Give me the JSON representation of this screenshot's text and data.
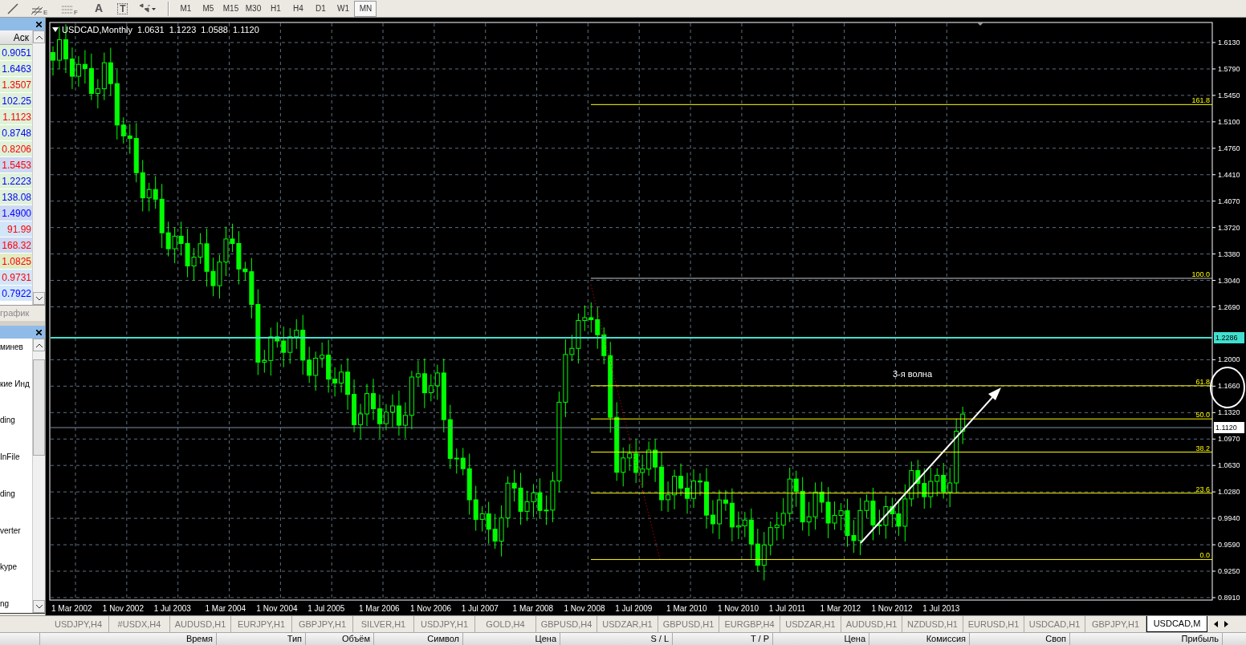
{
  "toolbar": {
    "tools": [
      {
        "kind": "trendline"
      },
      {
        "kind": "channel",
        "label": "E"
      },
      {
        "kind": "fibo",
        "label": "F"
      },
      {
        "kind": "text",
        "label": "A"
      },
      {
        "kind": "textlabel",
        "label": "T"
      },
      {
        "kind": "arrows"
      }
    ],
    "timeframes": [
      {
        "label": "M1",
        "selected": false
      },
      {
        "label": "M5",
        "selected": false
      },
      {
        "label": "M15",
        "selected": false
      },
      {
        "label": "M30",
        "selected": false
      },
      {
        "label": "H1",
        "selected": false
      },
      {
        "label": "H4",
        "selected": false
      },
      {
        "label": "D1",
        "selected": false
      },
      {
        "label": "W1",
        "selected": false
      },
      {
        "label": "MN",
        "selected": true
      }
    ]
  },
  "market_watch": {
    "column": "Аск",
    "rows": [
      {
        "ask": "0.9051",
        "color": "#0000ff",
        "kind": "green"
      },
      {
        "ask": "1.6463",
        "color": "#0000ff",
        "kind": "green"
      },
      {
        "ask": "1.3507",
        "color": "#ff0000",
        "kind": "green"
      },
      {
        "ask": "102.25",
        "color": "#0000ff",
        "kind": "green"
      },
      {
        "ask": "1.1123",
        "color": "#ff0000",
        "kind": "green"
      },
      {
        "ask": "0.8748",
        "color": "#0000ff",
        "kind": "green"
      },
      {
        "ask": "0.8206",
        "color": "#ff0000",
        "kind": "green"
      },
      {
        "ask": "1.5453",
        "color": "#ff0000",
        "kind": "lavender"
      },
      {
        "ask": "1.2223",
        "color": "#0000ff",
        "kind": "green"
      },
      {
        "ask": "138.08",
        "color": "#0000ff",
        "kind": "green"
      },
      {
        "ask": "1.4900",
        "color": "#0000ff",
        "kind": "lavender"
      },
      {
        "ask": "91.99",
        "color": "#ff0000",
        "kind": "sky"
      },
      {
        "ask": "168.32",
        "color": "#ff0000",
        "kind": "lavender"
      },
      {
        "ask": "1.0825",
        "color": "#ff0000",
        "kind": "olive"
      },
      {
        "ask": "0.9731",
        "color": "#ff0000",
        "kind": "sky"
      },
      {
        "ask": "0.7922",
        "color": "#0000ff",
        "kind": "sky"
      }
    ],
    "tab": "график"
  },
  "navigator": {
    "items": [
      "минев",
      "кие Инд",
      "ding",
      "InFile",
      "ding",
      "verter",
      "kype",
      "ng"
    ]
  },
  "chart": {
    "symbol": "USDCAD,Monthly",
    "ohlc": [
      "1.0631",
      "1.1223",
      "1.0588",
      "1.1120"
    ],
    "price_ticks": [
      "1.6130",
      "1.5790",
      "1.5450",
      "1.5100",
      "1.4760",
      "1.4410",
      "1.4070",
      "1.3720",
      "1.3380",
      "1.3040",
      "1.2690",
      "1.2000",
      "1.1660",
      "1.1320",
      "1.0970",
      "1.0630",
      "1.0280",
      "0.9940",
      "0.9590",
      "0.9250",
      "0.8910"
    ],
    "date_labels": [
      "1 Mar 2002",
      "1 Nov 2002",
      "1 Jul 2003",
      "1 Mar 2004",
      "1 Nov 2004",
      "1 Jul 2005",
      "1 Mar 2006",
      "1 Nov 2006",
      "1 Jul 2007",
      "1 Mar 2008",
      "1 Nov 2008",
      "1 Jul 2009",
      "1 Mar 2010",
      "1 Nov 2010",
      "1 Jul 2011",
      "1 Mar 2012",
      "1 Nov 2012",
      "1 Jul 2013"
    ],
    "fibo_levels": [
      "161.8",
      "100.0",
      "61.8",
      "50.0",
      "38.2",
      "23.6",
      "0.0"
    ],
    "horizontal_line_label": "1.2286",
    "current_price_label": "1.1120",
    "annotation": "3-я волна"
  },
  "chart_tabs": [
    {
      "label": "USDJPY,H4",
      "selected": false
    },
    {
      "label": "#USDX,H4",
      "selected": false
    },
    {
      "label": "AUDUSD,H1",
      "selected": false
    },
    {
      "label": "EURJPY,H1",
      "selected": false
    },
    {
      "label": "GBPJPY,H1",
      "selected": false
    },
    {
      "label": "SILVER,H1",
      "selected": false
    },
    {
      "label": "USDJPY,H1",
      "selected": false
    },
    {
      "label": "GOLD,H4",
      "selected": false
    },
    {
      "label": "GBPUSD,H4",
      "selected": false
    },
    {
      "label": "USDZAR,H1",
      "selected": false
    },
    {
      "label": "GBPUSD,H1",
      "selected": false
    },
    {
      "label": "EURGBP,H4",
      "selected": false
    },
    {
      "label": "USDZAR,H1",
      "selected": false
    },
    {
      "label": "AUDUSD,H1",
      "selected": false
    },
    {
      "label": "NZDUSD,H1",
      "selected": false
    },
    {
      "label": "EURUSD,H1",
      "selected": false
    },
    {
      "label": "USDCAD,H1",
      "selected": false
    },
    {
      "label": "GBPJPY,H1",
      "selected": false
    },
    {
      "label": "USDCAD,M",
      "selected": true
    }
  ],
  "orders_columns": [
    "Время",
    "Тип",
    "Объём",
    "Символ",
    "Цена",
    "S / L",
    "T / P",
    "Цена",
    "Комиссия",
    "Своп",
    "Прибыль"
  ]
}
